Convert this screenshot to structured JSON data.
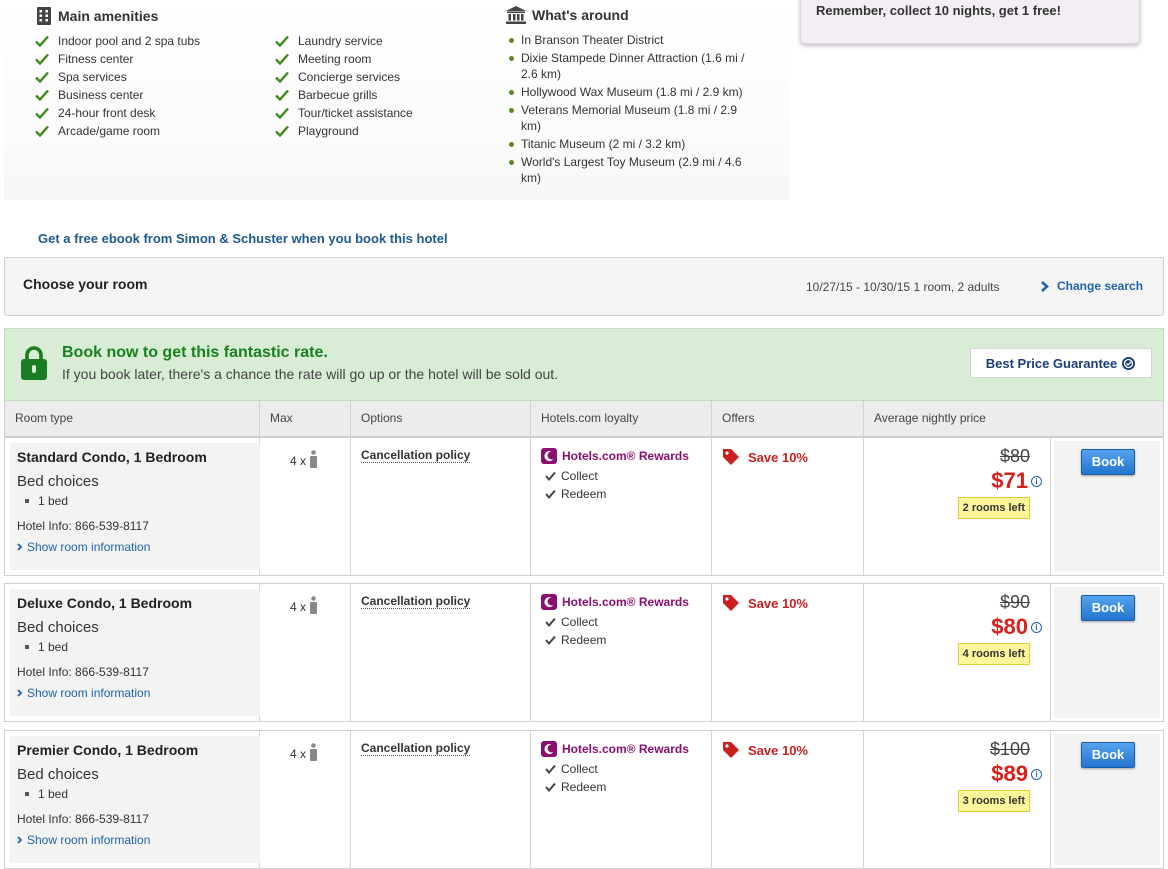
{
  "amenities": {
    "title": "Main amenities",
    "col1": [
      "Indoor pool and 2 spa tubs",
      "Fitness center",
      "Spa services",
      "Business center",
      "24-hour front desk",
      "Arcade/game room"
    ],
    "col2": [
      "Laundry service",
      "Meeting room",
      "Concierge services",
      "Barbecue grills",
      "Tour/ticket assistance",
      "Playground"
    ]
  },
  "around": {
    "title": "What's around",
    "items": [
      "In Branson Theater District",
      "Dixie Stampede Dinner Attraction (1.6 mi / 2.6 km)",
      "Hollywood Wax Museum (1.8 mi / 2.9 km)",
      "Veterans Memorial Museum (1.8 mi / 2.9 km)",
      "Titanic Museum (2 mi / 3.2 km)",
      "World's Largest Toy Museum (2.9 mi / 4.6 km)"
    ]
  },
  "promo": {
    "text": "Remember, collect 10 nights, get 1 free!"
  },
  "ebook": {
    "text": "Get a free ebook from Simon & Schuster when you book this hotel"
  },
  "choose": {
    "title": "Choose your room",
    "dates": "10/27/15 - 10/30/15",
    "guests": "1 room, 2 adults",
    "change_search": "Change search"
  },
  "banner": {
    "title": "Book now to get this fantastic rate.",
    "subtitle": "If you book later, there's a chance the rate will go up or the hotel will be sold out.",
    "guarantee": "Best Price Guarantee"
  },
  "table": {
    "headers": [
      "Room type",
      "Max",
      "Options",
      "Hotels.com loyalty",
      "Offers",
      "Average nightly price"
    ]
  },
  "rooms": [
    {
      "name": "Standard Condo, 1 Bedroom",
      "bed_choices": "Bed choices",
      "bed": "1 bed",
      "hotel_info": "Hotel Info: 866-539-8117",
      "show_info": "Show room information",
      "max": "4 x",
      "cancel": "Cancellation policy",
      "loyalty": "Hotels.com® Rewards",
      "collect": "Collect",
      "redeem": "Redeem",
      "offer": "Save 10%",
      "old_price": "$80",
      "new_price": "$71",
      "rooms_left": "2 rooms left",
      "book": "Book"
    },
    {
      "name": "Deluxe Condo, 1 Bedroom",
      "bed_choices": "Bed choices",
      "bed": "1 bed",
      "hotel_info": "Hotel Info: 866-539-8117",
      "show_info": "Show room information",
      "max": "4 x",
      "cancel": "Cancellation policy",
      "loyalty": "Hotels.com® Rewards",
      "collect": "Collect",
      "redeem": "Redeem",
      "offer": "Save 10%",
      "old_price": "$90",
      "new_price": "$80",
      "rooms_left": "4 rooms left",
      "book": "Book"
    },
    {
      "name": "Premier Condo, 1 Bedroom",
      "bed_choices": "Bed choices",
      "bed": "1 bed",
      "hotel_info": "Hotel Info: 866-539-8117",
      "show_info": "Show room information",
      "max": "4 x",
      "cancel": "Cancellation policy",
      "loyalty": "Hotels.com® Rewards",
      "collect": "Collect",
      "redeem": "Redeem",
      "offer": "Save 10%",
      "old_price": "$100",
      "new_price": "$89",
      "rooms_left": "3 rooms left",
      "book": "Book"
    }
  ],
  "colors": {
    "accent_green": "#17821c",
    "price_red": "#d8201c",
    "link_blue": "#1e63ad",
    "loyalty_purple": "#8a0f6e"
  },
  "icons": {
    "amenities": "building-icon",
    "around": "landmark-icon",
    "check": "checkmark-icon",
    "lock": "lock-icon",
    "person": "person-icon",
    "tag": "price-tag-icon",
    "rewards": "moon-rewards-icon",
    "info": "info-icon",
    "chevron": "chevron-right-icon"
  }
}
